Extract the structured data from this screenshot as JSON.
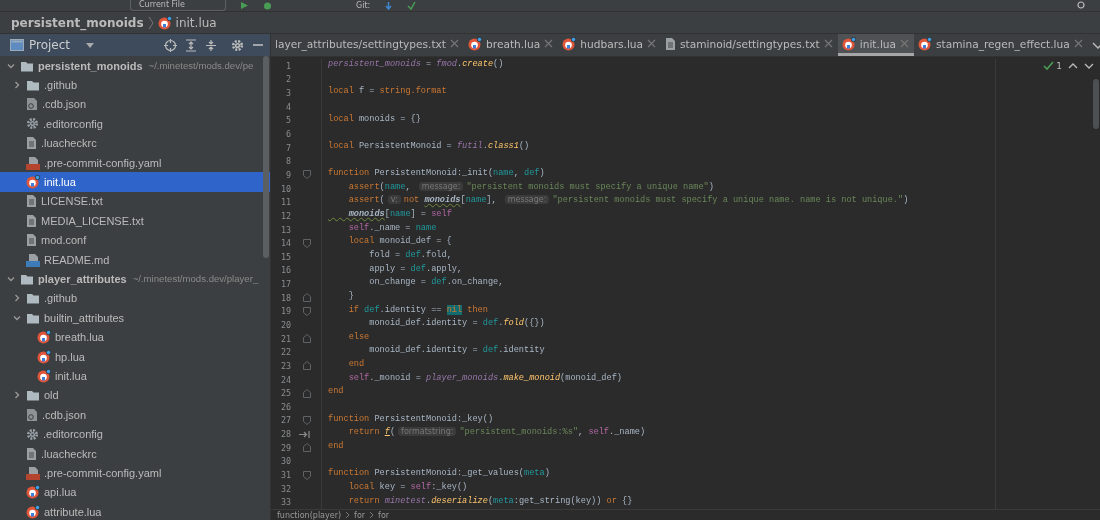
{
  "toolbar": {
    "configuration": "Current File",
    "git_label": "Git:"
  },
  "breadcrumb": {
    "project": "persistent_monoids",
    "file": "init.lua",
    "kind": "lua"
  },
  "project_panel": {
    "title": "Project",
    "tree": [
      {
        "name": "persistent_monoids",
        "path": "~/.minetest/mods.dev/pe",
        "kind": "folder",
        "expanded": true,
        "selected": false,
        "children": [
          {
            "name": ".github",
            "kind": "folder",
            "expanded": false,
            "selected": false
          },
          {
            "name": ".cdb.json",
            "kind": "json",
            "selected": false
          },
          {
            "name": ".editorconfig",
            "kind": "config",
            "selected": false
          },
          {
            "name": ".luacheckrc",
            "kind": "text",
            "selected": false
          },
          {
            "name": ".pre-commit-config.yaml",
            "kind": "yaml",
            "selected": false
          },
          {
            "name": "init.lua",
            "kind": "lua",
            "selected": true
          },
          {
            "name": "LICENSE.txt",
            "kind": "text",
            "selected": false
          },
          {
            "name": "MEDIA_LICENSE.txt",
            "kind": "text",
            "selected": false
          },
          {
            "name": "mod.conf",
            "kind": "text",
            "selected": false
          },
          {
            "name": "README.md",
            "kind": "markdown",
            "selected": false
          }
        ]
      },
      {
        "name": "player_attributes",
        "path": "~/.minetest/mods.dev/player_",
        "kind": "folder",
        "expanded": true,
        "selected": false,
        "children": [
          {
            "name": ".github",
            "kind": "folder",
            "expanded": false,
            "selected": false
          },
          {
            "name": "builtin_attributes",
            "kind": "folder",
            "expanded": true,
            "selected": false,
            "children": [
              {
                "name": "breath.lua",
                "kind": "lua",
                "selected": false
              },
              {
                "name": "hp.lua",
                "kind": "lua",
                "selected": false
              },
              {
                "name": "init.lua",
                "kind": "lua",
                "selected": false
              }
            ]
          },
          {
            "name": "old",
            "kind": "folder",
            "expanded": false,
            "selected": false
          },
          {
            "name": ".cdb.json",
            "kind": "json",
            "selected": false
          },
          {
            "name": ".editorconfig",
            "kind": "config",
            "selected": false
          },
          {
            "name": ".luacheckrc",
            "kind": "text",
            "selected": false
          },
          {
            "name": ".pre-commit-config.yaml",
            "kind": "yaml",
            "selected": false
          },
          {
            "name": "api.lua",
            "kind": "lua",
            "selected": false
          },
          {
            "name": "attribute.lua",
            "kind": "lua",
            "selected": false
          }
        ]
      }
    ]
  },
  "tabs": [
    {
      "label": "layer_attributes/settingtypes.txt",
      "selected": false
    },
    {
      "label": "breath.lua",
      "kind": "lua",
      "selected": false
    },
    {
      "label": "hudbars.lua",
      "kind": "lua",
      "selected": false
    },
    {
      "label": "staminoid/settingtypes.txt",
      "kind": "text",
      "selected": false
    },
    {
      "label": "init.lua",
      "kind": "lua",
      "selected": true
    },
    {
      "label": "stamina_regen_effect.lua",
      "kind": "lua",
      "selected": false
    }
  ],
  "inspections": {
    "count": "1"
  },
  "code": [
    {
      "number": "1",
      "tokens": [
        {
          "kind": "global",
          "text": "persistent_monoids"
        },
        {
          "kind": "plain",
          "text": " = "
        },
        {
          "kind": "global",
          "text": "fmod"
        },
        {
          "kind": "plain",
          "text": "."
        },
        {
          "kind": "fn",
          "text": "create"
        },
        {
          "kind": "plain",
          "text": "()"
        }
      ]
    },
    {
      "number": "2"
    },
    {
      "number": "3",
      "tokens": [
        {
          "kind": "kw",
          "text": "local"
        },
        {
          "kind": "plain",
          "text": " f = "
        },
        {
          "kind": "kw",
          "text": "string.format"
        }
      ]
    },
    {
      "number": "4"
    },
    {
      "number": "5",
      "tokens": [
        {
          "kind": "kw",
          "text": "local"
        },
        {
          "kind": "plain",
          "text": " monoids = {}"
        }
      ]
    },
    {
      "number": "6"
    },
    {
      "number": "7",
      "tokens": [
        {
          "kind": "kw",
          "text": "local"
        },
        {
          "kind": "plain",
          "text": " PersistentMonoid = "
        },
        {
          "kind": "global",
          "text": "futil"
        },
        {
          "kind": "plain",
          "text": "."
        },
        {
          "kind": "fn",
          "text": "class1"
        },
        {
          "kind": "plain",
          "text": "()"
        }
      ]
    },
    {
      "number": "8"
    },
    {
      "number": "9",
      "kind": "fold-start",
      "tokens": [
        {
          "kind": "kw",
          "text": "function"
        },
        {
          "kind": "plain",
          "text": " PersistentMonoid:_init("
        },
        {
          "kind": "param",
          "text": "name"
        },
        {
          "kind": "plain",
          "text": ", "
        },
        {
          "kind": "param",
          "text": "def"
        },
        {
          "kind": "plain",
          "text": ")"
        }
      ]
    },
    {
      "number": "10",
      "tokens": [
        {
          "kind": "kw",
          "text": "    assert"
        },
        {
          "kind": "plain",
          "text": "("
        },
        {
          "kind": "param",
          "text": "name"
        },
        {
          "kind": "plain",
          "text": ", "
        },
        {
          "kind": "hint",
          "text": "message:"
        },
        {
          "kind": "str",
          "text": "\"persistent monoids must specify a unique name\""
        },
        {
          "kind": "plain",
          "text": ")"
        }
      ]
    },
    {
      "number": "11",
      "tokens": [
        {
          "kind": "kw",
          "text": "    assert"
        },
        {
          "kind": "plain",
          "text": "("
        },
        {
          "kind": "hint",
          "text": "v:"
        },
        {
          "kind": "kw",
          "text": "not "
        },
        {
          "kind": "warn",
          "text": "monoids"
        },
        {
          "kind": "plain",
          "text": "["
        },
        {
          "kind": "param",
          "text": "name"
        },
        {
          "kind": "plain",
          "text": "], "
        },
        {
          "kind": "hint",
          "text": "message:"
        },
        {
          "kind": "str",
          "text": "\"persistent monoids must specify a unique name. name is not unique.\""
        },
        {
          "kind": "plain",
          "text": ")"
        }
      ]
    },
    {
      "number": "12",
      "tokens": [
        {
          "kind": "warn",
          "text": "    monoids"
        },
        {
          "kind": "plain",
          "text": "["
        },
        {
          "kind": "param",
          "text": "name"
        },
        {
          "kind": "plain",
          "text": "] = "
        },
        {
          "kind": "self",
          "text": "self"
        }
      ]
    },
    {
      "number": "13",
      "tokens": [
        {
          "kind": "self",
          "text": "    self"
        },
        {
          "kind": "plain",
          "text": "._name = "
        },
        {
          "kind": "param",
          "text": "name"
        }
      ]
    },
    {
      "number": "14",
      "kind": "fold-start",
      "tokens": [
        {
          "kind": "kw",
          "text": "    local"
        },
        {
          "kind": "plain",
          "text": " monoid_def = {"
        }
      ]
    },
    {
      "number": "15",
      "tokens": [
        {
          "kind": "plain",
          "text": "        fold = "
        },
        {
          "kind": "param",
          "text": "def"
        },
        {
          "kind": "plain",
          "text": ".fold,"
        }
      ]
    },
    {
      "number": "16",
      "tokens": [
        {
          "kind": "plain",
          "text": "        apply = "
        },
        {
          "kind": "param",
          "text": "def"
        },
        {
          "kind": "plain",
          "text": ".apply,"
        }
      ]
    },
    {
      "number": "17",
      "tokens": [
        {
          "kind": "plain",
          "text": "        on_change = "
        },
        {
          "kind": "param",
          "text": "def"
        },
        {
          "kind": "plain",
          "text": ".on_change,"
        }
      ]
    },
    {
      "number": "18",
      "kind": "fold-end",
      "tokens": [
        {
          "kind": "plain",
          "text": "    }"
        }
      ]
    },
    {
      "number": "19",
      "kind": "fold-start",
      "tokens": [
        {
          "kind": "kw",
          "text": "    if "
        },
        {
          "kind": "param",
          "text": "def"
        },
        {
          "kind": "plain",
          "text": ".identity == "
        },
        {
          "kind": "match",
          "text": "nil"
        },
        {
          "kind": "kw",
          "text": " then"
        }
      ]
    },
    {
      "number": "20",
      "tokens": [
        {
          "kind": "plain",
          "text": "        monoid_def.identity = "
        },
        {
          "kind": "param",
          "text": "def"
        },
        {
          "kind": "plain",
          "text": "."
        },
        {
          "kind": "fn",
          "text": "fold"
        },
        {
          "kind": "plain",
          "text": "({})"
        }
      ]
    },
    {
      "number": "21",
      "kind": "fold-end",
      "tokens": [
        {
          "kind": "kw",
          "text": "    else"
        }
      ]
    },
    {
      "number": "22",
      "tokens": [
        {
          "kind": "plain",
          "text": "        monoid_def.identity = "
        },
        {
          "kind": "param",
          "text": "def"
        },
        {
          "kind": "plain",
          "text": ".identity"
        }
      ]
    },
    {
      "number": "23",
      "kind": "fold-end",
      "tokens": [
        {
          "kind": "kw",
          "text": "    end"
        }
      ]
    },
    {
      "number": "24",
      "tokens": [
        {
          "kind": "self",
          "text": "    self"
        },
        {
          "kind": "plain",
          "text": "._monoid = "
        },
        {
          "kind": "global",
          "text": "player_monoids"
        },
        {
          "kind": "plain",
          "text": "."
        },
        {
          "kind": "fn",
          "text": "make_monoid"
        },
        {
          "kind": "plain",
          "text": "(monoid_def)"
        }
      ]
    },
    {
      "number": "25",
      "kind": "fold-end",
      "tokens": [
        {
          "kind": "kw",
          "text": "end"
        }
      ]
    },
    {
      "number": "26"
    },
    {
      "number": "27",
      "kind": "fold-start",
      "tokens": [
        {
          "kind": "kw",
          "text": "function"
        },
        {
          "kind": "plain",
          "text": " PersistentMonoid:_key()"
        }
      ]
    },
    {
      "number": "28",
      "kind": "return",
      "tokens": [
        {
          "kind": "kw",
          "text": "    return "
        },
        {
          "kind": "fnu",
          "text": "f"
        },
        {
          "kind": "plain",
          "text": "("
        },
        {
          "kind": "hint",
          "text": "formatstring:"
        },
        {
          "kind": "str",
          "text": "\"persistent_monoids:%s\""
        },
        {
          "kind": "plain",
          "text": ", "
        },
        {
          "kind": "self",
          "text": "self"
        },
        {
          "kind": "plain",
          "text": "._name)"
        }
      ]
    },
    {
      "number": "29",
      "kind": "fold-end",
      "tokens": [
        {
          "kind": "kw",
          "text": "end"
        }
      ]
    },
    {
      "number": "30"
    },
    {
      "number": "31",
      "kind": "fold-start",
      "tokens": [
        {
          "kind": "kw",
          "text": "function"
        },
        {
          "kind": "plain",
          "text": " PersistentMonoid:_get_values("
        },
        {
          "kind": "param",
          "text": "meta"
        },
        {
          "kind": "plain",
          "text": ")"
        }
      ]
    },
    {
      "number": "32",
      "tokens": [
        {
          "kind": "kw",
          "text": "    local"
        },
        {
          "kind": "plain",
          "text": " key = "
        },
        {
          "kind": "self",
          "text": "self"
        },
        {
          "kind": "plain",
          "text": ":_key()"
        }
      ]
    },
    {
      "number": "33",
      "tokens": [
        {
          "kind": "kw",
          "text": "    return "
        },
        {
          "kind": "global",
          "text": "minetest"
        },
        {
          "kind": "plain",
          "text": "."
        },
        {
          "kind": "fn",
          "text": "deserialize"
        },
        {
          "kind": "plain",
          "text": "("
        },
        {
          "kind": "param",
          "text": "meta"
        },
        {
          "kind": "plain",
          "text": ":get_string(key)) "
        },
        {
          "kind": "kw",
          "text": "or"
        },
        {
          "kind": "plain",
          "text": " {}"
        }
      ]
    }
  ],
  "code_breadcrumb": [
    "function(player)",
    "for",
    "for"
  ]
}
